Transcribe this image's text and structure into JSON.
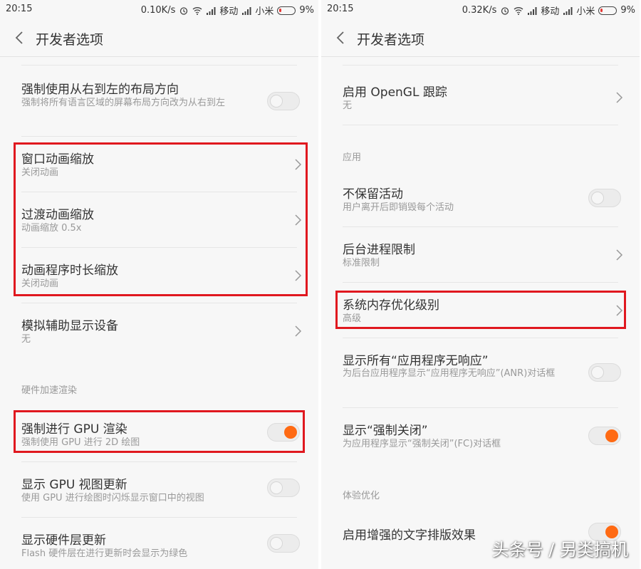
{
  "accent_color": "#ff6a13",
  "highlight_color": "#e0181f",
  "left": {
    "status": {
      "time": "20:15",
      "speed": "0.10K/s",
      "carrier1": "移动",
      "carrier2": "小米",
      "battery": "9%"
    },
    "title": "开发者选项",
    "items": [
      {
        "title": "强制使用从右到左的布局方向",
        "subtitle": "强制将所有语言区域的屏幕布局方向改为从右到左",
        "control": "toggle",
        "on": false
      },
      {
        "title": "窗口动画缩放",
        "subtitle": "关闭动画",
        "control": "chevron"
      },
      {
        "title": "过渡动画缩放",
        "subtitle": "动画缩放 0.5x",
        "control": "chevron"
      },
      {
        "title": "动画程序时长缩放",
        "subtitle": "关闭动画",
        "control": "chevron"
      },
      {
        "title": "模拟辅助显示设备",
        "subtitle": "无",
        "control": "chevron"
      },
      {
        "title": "强制进行 GPU 渲染",
        "subtitle": "强制使用 GPU 进行 2D 绘图",
        "control": "toggle",
        "on": true
      },
      {
        "title": "显示 GPU 视图更新",
        "subtitle": "使用 GPU 进行绘图时闪烁显示窗口中的视图",
        "control": "toggle",
        "on": false
      },
      {
        "title": "显示硬件层更新",
        "subtitle": "Flash 硬件层在进行更新时会显示为绿色",
        "control": "toggle",
        "on": false
      }
    ],
    "section_hw": "硬件加速渲染"
  },
  "right": {
    "status": {
      "time": "20:15",
      "speed": "0.32K/s",
      "carrier1": "移动",
      "carrier2": "小米",
      "battery": "9%"
    },
    "title": "开发者选项",
    "items": [
      {
        "title": "启用 OpenGL 跟踪",
        "subtitle": "无",
        "control": "chevron"
      },
      {
        "title": "不保留活动",
        "subtitle": "用户离开后即销毁每个活动",
        "control": "toggle",
        "on": false
      },
      {
        "title": "后台进程限制",
        "subtitle": "标准限制",
        "control": "chevron"
      },
      {
        "title": "系统内存优化级别",
        "subtitle": "高级",
        "control": "chevron"
      },
      {
        "title": "显示所有“应用程序无响应”",
        "subtitle": "为后台应用程序显示“应用程序无响应”(ANR)对话框",
        "control": "toggle",
        "on": false
      },
      {
        "title": "显示“强制关闭”",
        "subtitle": "为应用程序显示“强制关闭”(FC)对话框",
        "control": "toggle",
        "on": true
      },
      {
        "title": "启用增强的文字排版效果",
        "subtitle": "",
        "control": "toggle",
        "on": true
      }
    ],
    "section_apps": "应用",
    "section_exp": "体验优化"
  },
  "watermark": "头条号 / 另类搞机"
}
